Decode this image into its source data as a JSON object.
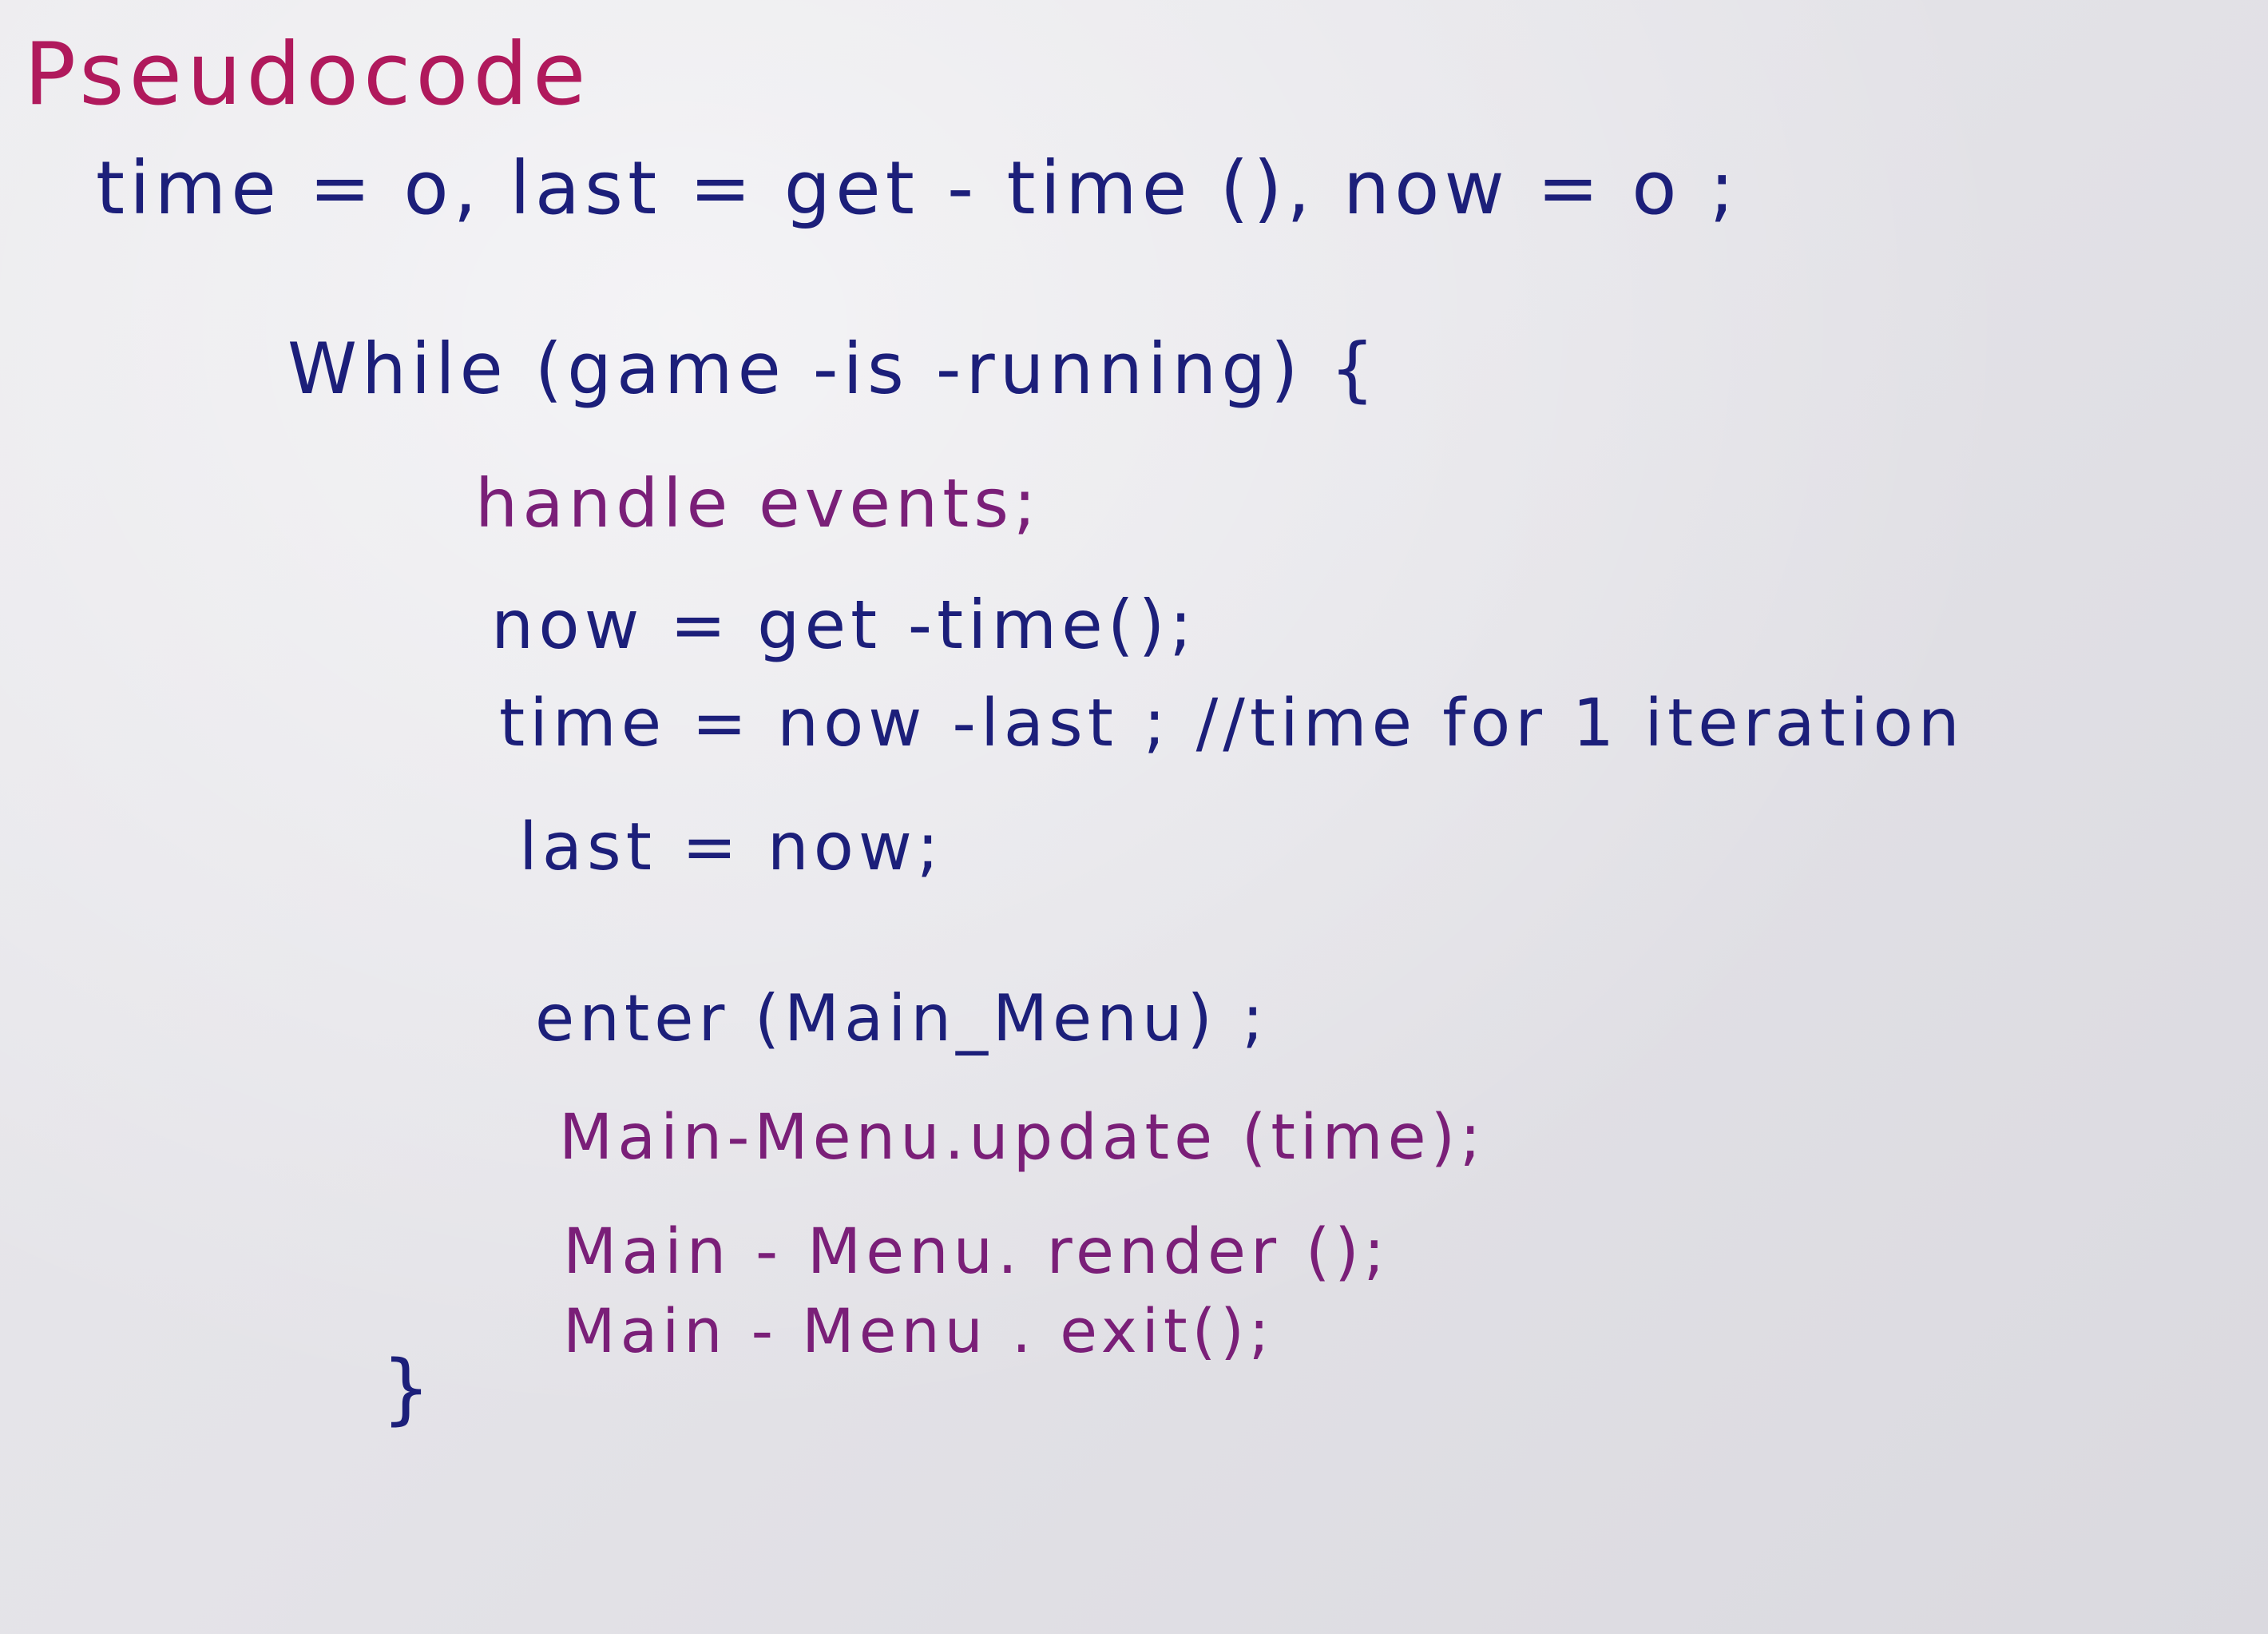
{
  "document": {
    "title": "Pseudocode",
    "lines": [
      "time = o, last = get - time (), now = o ;",
      "While (game -is -running) {",
      "handle events;",
      "now = get -time();",
      "time = now -last ; //time for 1 iteration",
      "last = now;",
      "enter (Main_Menu) ;",
      "Main-Menu.update (time);",
      "Main - Menu. render ();",
      "Main - Menu . exit();",
      "}"
    ]
  },
  "colors": {
    "code_ink": "#1c1f7a",
    "title_ink": "#b0195c",
    "keyword_ink": "#7a1f78",
    "paper": "#e6e5ea"
  }
}
